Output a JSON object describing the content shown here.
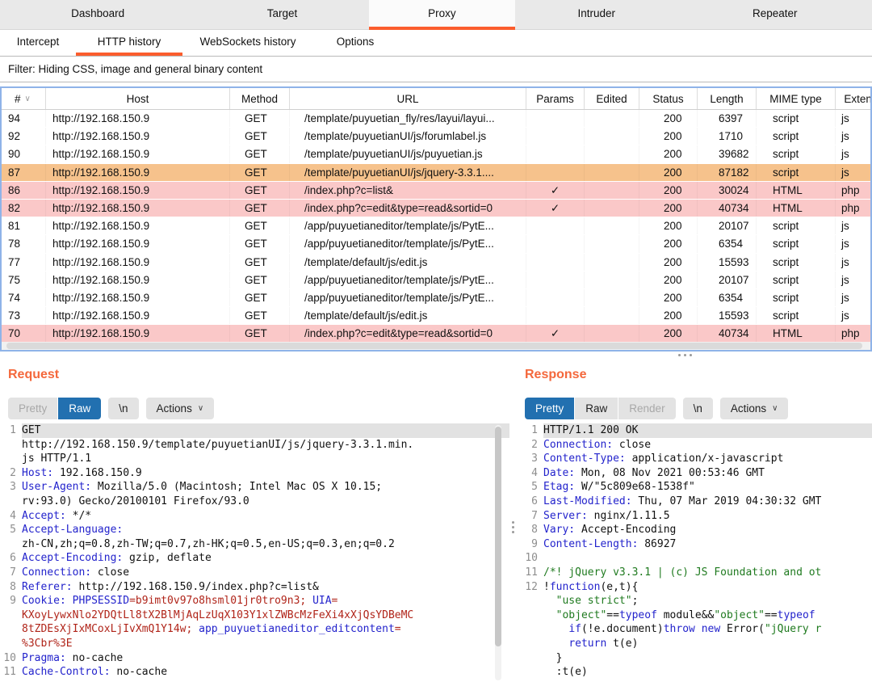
{
  "colors": {
    "accent_orange": "#fb5d2d",
    "panel_title_orange": "#f4683c",
    "selected_row_orange": "#f6c28c",
    "marked_row_pink": "#fac8c8",
    "selected_button_blue": "#2270b0",
    "syntax_header_blue": "#2323cc",
    "syntax_value_red": "#b02419",
    "syntax_string_green": "#1f7a1f",
    "table_focus_border_blue": "#8fb3e8"
  },
  "top_tabs": {
    "items": [
      {
        "label": "Dashboard",
        "selected": false
      },
      {
        "label": "Target",
        "selected": false
      },
      {
        "label": "Proxy",
        "selected": true
      },
      {
        "label": "Intruder",
        "selected": false
      },
      {
        "label": "Repeater",
        "selected": false
      }
    ]
  },
  "sub_tabs": {
    "items": [
      {
        "label": "Intercept",
        "selected": false
      },
      {
        "label": "HTTP history",
        "selected": true
      },
      {
        "label": "WebSockets history",
        "selected": false
      },
      {
        "label": "Options",
        "selected": false
      }
    ]
  },
  "filter": {
    "text": "Filter: Hiding CSS, image and general binary content"
  },
  "table": {
    "sort_indicator": "∨",
    "checkmark": "✓",
    "columns": [
      "#",
      "Host",
      "Method",
      "URL",
      "Params",
      "Edited",
      "Status",
      "Length",
      "MIME type",
      "Extension"
    ],
    "rows": [
      {
        "id": "94",
        "host": "http://192.168.150.9",
        "method": "GET",
        "url": "/template/puyuetian_fly/res/layui/layui...",
        "params": false,
        "edited": false,
        "status": "200",
        "length": "6397",
        "mime": "script",
        "ext": "js",
        "mark": "none"
      },
      {
        "id": "92",
        "host": "http://192.168.150.9",
        "method": "GET",
        "url": "/template/puyuetianUI/js/forumlabel.js",
        "params": false,
        "edited": false,
        "status": "200",
        "length": "1710",
        "mime": "script",
        "ext": "js",
        "mark": "none"
      },
      {
        "id": "90",
        "host": "http://192.168.150.9",
        "method": "GET",
        "url": "/template/puyuetianUI/js/puyuetian.js",
        "params": false,
        "edited": false,
        "status": "200",
        "length": "39682",
        "mime": "script",
        "ext": "js",
        "mark": "none"
      },
      {
        "id": "87",
        "host": "http://192.168.150.9",
        "method": "GET",
        "url": "/template/puyuetianUI/js/jquery-3.3.1....",
        "params": false,
        "edited": false,
        "status": "200",
        "length": "87182",
        "mime": "script",
        "ext": "js",
        "mark": "orange"
      },
      {
        "id": "86",
        "host": "http://192.168.150.9",
        "method": "GET",
        "url": "/index.php?c=list&",
        "params": true,
        "edited": false,
        "status": "200",
        "length": "30024",
        "mime": "HTML",
        "ext": "php",
        "mark": "pink"
      },
      {
        "id": "82",
        "host": "http://192.168.150.9",
        "method": "GET",
        "url": "/index.php?c=edit&type=read&sortid=0",
        "params": true,
        "edited": false,
        "status": "200",
        "length": "40734",
        "mime": "HTML",
        "ext": "php",
        "mark": "pink"
      },
      {
        "id": "81",
        "host": "http://192.168.150.9",
        "method": "GET",
        "url": "/app/puyuetianeditor/template/js/PytE...",
        "params": false,
        "edited": false,
        "status": "200",
        "length": "20107",
        "mime": "script",
        "ext": "js",
        "mark": "none"
      },
      {
        "id": "78",
        "host": "http://192.168.150.9",
        "method": "GET",
        "url": "/app/puyuetianeditor/template/js/PytE...",
        "params": false,
        "edited": false,
        "status": "200",
        "length": "6354",
        "mime": "script",
        "ext": "js",
        "mark": "none"
      },
      {
        "id": "77",
        "host": "http://192.168.150.9",
        "method": "GET",
        "url": "/template/default/js/edit.js",
        "params": false,
        "edited": false,
        "status": "200",
        "length": "15593",
        "mime": "script",
        "ext": "js",
        "mark": "none"
      },
      {
        "id": "75",
        "host": "http://192.168.150.9",
        "method": "GET",
        "url": "/app/puyuetianeditor/template/js/PytE...",
        "params": false,
        "edited": false,
        "status": "200",
        "length": "20107",
        "mime": "script",
        "ext": "js",
        "mark": "none"
      },
      {
        "id": "74",
        "host": "http://192.168.150.9",
        "method": "GET",
        "url": "/app/puyuetianeditor/template/js/PytE...",
        "params": false,
        "edited": false,
        "status": "200",
        "length": "6354",
        "mime": "script",
        "ext": "js",
        "mark": "none"
      },
      {
        "id": "73",
        "host": "http://192.168.150.9",
        "method": "GET",
        "url": "/template/default/js/edit.js",
        "params": false,
        "edited": false,
        "status": "200",
        "length": "15593",
        "mime": "script",
        "ext": "js",
        "mark": "none"
      },
      {
        "id": "70",
        "host": "http://192.168.150.9",
        "method": "GET",
        "url": "/index.php?c=edit&type=read&sortid=0",
        "params": true,
        "edited": false,
        "status": "200",
        "length": "40734",
        "mime": "HTML",
        "ext": "php",
        "mark": "pink"
      }
    ]
  },
  "request": {
    "title": "Request",
    "tabs": [
      {
        "label": "Pretty",
        "state": "dis"
      },
      {
        "label": "Raw",
        "state": "sel"
      }
    ],
    "newline_label": "\\n",
    "actions_label": "Actions",
    "lines": [
      {
        "n": "1",
        "hl": true,
        "seg": [
          [
            "k",
            "GET"
          ]
        ]
      },
      {
        "n": "",
        "seg": [
          [
            "k",
            "http://192.168.150.9/template/puyuetianUI/js/jquery-3.3.1.min."
          ]
        ]
      },
      {
        "n": "",
        "seg": [
          [
            "k",
            "js HTTP/1.1"
          ]
        ]
      },
      {
        "n": "2",
        "seg": [
          [
            "h",
            "Host:"
          ],
          [
            "k",
            " 192.168.150.9"
          ]
        ]
      },
      {
        "n": "3",
        "seg": [
          [
            "h",
            "User-Agent:"
          ],
          [
            "k",
            " Mozilla/5.0 (Macintosh; Intel Mac OS X 10.15;"
          ]
        ]
      },
      {
        "n": "",
        "seg": [
          [
            "k",
            "rv:93.0) Gecko/20100101 Firefox/93.0"
          ]
        ]
      },
      {
        "n": "4",
        "seg": [
          [
            "h",
            "Accept:"
          ],
          [
            "k",
            " */*"
          ]
        ]
      },
      {
        "n": "5",
        "seg": [
          [
            "h",
            "Accept-Language:"
          ]
        ]
      },
      {
        "n": "",
        "seg": [
          [
            "k",
            "zh-CN,zh;q=0.8,zh-TW;q=0.7,zh-HK;q=0.5,en-US;q=0.3,en;q=0.2"
          ]
        ]
      },
      {
        "n": "6",
        "seg": [
          [
            "h",
            "Accept-Encoding:"
          ],
          [
            "k",
            " gzip, deflate"
          ]
        ]
      },
      {
        "n": "7",
        "seg": [
          [
            "h",
            "Connection:"
          ],
          [
            "k",
            " close"
          ]
        ]
      },
      {
        "n": "8",
        "seg": [
          [
            "h",
            "Referer:"
          ],
          [
            "k",
            " http://192.168.150.9/index.php?c=list&"
          ]
        ]
      },
      {
        "n": "9",
        "seg": [
          [
            "h",
            "Cookie:"
          ],
          [
            "k",
            " "
          ],
          [
            "h",
            "PHPSESSID"
          ],
          [
            "r",
            "=b9imt0v97o8hsml01jr0tro9n3; "
          ],
          [
            "h",
            "UIA"
          ],
          [
            "r",
            "="
          ]
        ]
      },
      {
        "n": "",
        "seg": [
          [
            "r",
            "KXoyLywxNlo2YDQtLl8tX2BlMjAqLzUqX103Y1xlZWBcMzFeXi4xXjQsYDBeMC"
          ]
        ]
      },
      {
        "n": "",
        "seg": [
          [
            "r",
            "8tZDEsXjIxMCoxLjIvXmQ1Y14w; "
          ],
          [
            "h",
            "app_puyuetianeditor_editcontent"
          ],
          [
            "r",
            "="
          ]
        ]
      },
      {
        "n": "",
        "seg": [
          [
            "r",
            "%3Cbr%3E"
          ]
        ]
      },
      {
        "n": "10",
        "seg": [
          [
            "h",
            "Pragma:"
          ],
          [
            "k",
            " no-cache"
          ]
        ]
      },
      {
        "n": "11",
        "seg": [
          [
            "h",
            "Cache-Control:"
          ],
          [
            "k",
            " no-cache"
          ]
        ]
      }
    ]
  },
  "response": {
    "title": "Response",
    "tabs": [
      {
        "label": "Pretty",
        "state": "sel"
      },
      {
        "label": "Raw",
        "state": ""
      },
      {
        "label": "Render",
        "state": "dis"
      }
    ],
    "newline_label": "\\n",
    "actions_label": "Actions",
    "lines": [
      {
        "n": "1",
        "hl": true,
        "seg": [
          [
            "k",
            "HTTP/1.1 200 OK"
          ]
        ]
      },
      {
        "n": "2",
        "seg": [
          [
            "h",
            "Connection:"
          ],
          [
            "k",
            " close"
          ]
        ]
      },
      {
        "n": "3",
        "seg": [
          [
            "h",
            "Content-Type:"
          ],
          [
            "k",
            " application/x-javascript"
          ]
        ]
      },
      {
        "n": "4",
        "seg": [
          [
            "h",
            "Date:"
          ],
          [
            "k",
            " Mon, 08 Nov 2021 00:53:46 GMT"
          ]
        ]
      },
      {
        "n": "5",
        "seg": [
          [
            "h",
            "Etag:"
          ],
          [
            "k",
            " W/\"5c809e68-1538f\""
          ]
        ]
      },
      {
        "n": "6",
        "seg": [
          [
            "h",
            "Last-Modified:"
          ],
          [
            "k",
            " Thu, 07 Mar 2019 04:30:32 GMT"
          ]
        ]
      },
      {
        "n": "7",
        "seg": [
          [
            "h",
            "Server:"
          ],
          [
            "k",
            " nginx/1.11.5"
          ]
        ]
      },
      {
        "n": "8",
        "seg": [
          [
            "h",
            "Vary:"
          ],
          [
            "k",
            " Accept-Encoding"
          ]
        ]
      },
      {
        "n": "9",
        "seg": [
          [
            "h",
            "Content-Length:"
          ],
          [
            "k",
            " 86927"
          ]
        ]
      },
      {
        "n": "10",
        "seg": []
      },
      {
        "n": "11",
        "seg": [
          [
            "g",
            "/*! jQuery v3.3.1 | (c) JS Foundation and ot"
          ]
        ]
      },
      {
        "n": "12",
        "seg": [
          [
            "k",
            "!"
          ],
          [
            "h",
            "function"
          ],
          [
            "k",
            "(e,t){"
          ]
        ]
      },
      {
        "n": "",
        "seg": [
          [
            "k",
            "  "
          ],
          [
            "g",
            "\"use strict\""
          ],
          [
            "k",
            ";"
          ]
        ]
      },
      {
        "n": "",
        "seg": [
          [
            "k",
            "  "
          ],
          [
            "g",
            "\"object\""
          ],
          [
            "k",
            "=="
          ],
          [
            "h",
            "typeof"
          ],
          [
            "k",
            " module&&"
          ],
          [
            "g",
            "\"object\""
          ],
          [
            "k",
            "=="
          ],
          [
            "h",
            "typeof"
          ]
        ]
      },
      {
        "n": "",
        "seg": [
          [
            "k",
            "    "
          ],
          [
            "h",
            "if"
          ],
          [
            "k",
            "(!e.document)"
          ],
          [
            "h",
            "throw"
          ],
          [
            "k",
            " "
          ],
          [
            "h",
            "new"
          ],
          [
            "k",
            " Error("
          ],
          [
            "g",
            "\"jQuery r"
          ]
        ]
      },
      {
        "n": "",
        "seg": [
          [
            "k",
            "    "
          ],
          [
            "h",
            "return"
          ],
          [
            "k",
            " t(e)"
          ]
        ]
      },
      {
        "n": "",
        "seg": [
          [
            "k",
            "  }"
          ]
        ]
      },
      {
        "n": "",
        "seg": [
          [
            "k",
            "  :t(e)"
          ]
        ]
      }
    ]
  }
}
